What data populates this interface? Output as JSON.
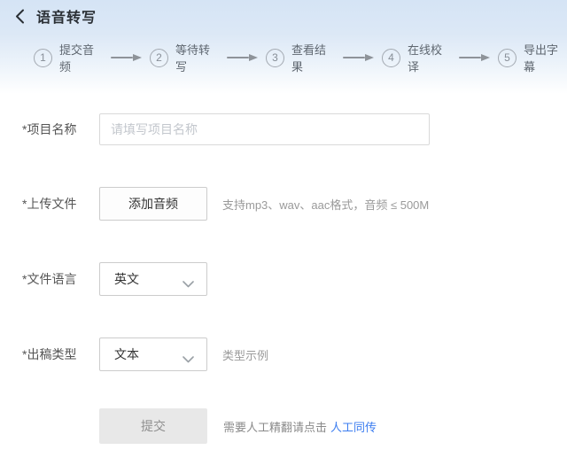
{
  "header": {
    "title": "语音转写",
    "back_icon": "chevron-left"
  },
  "steps": [
    {
      "number": "1",
      "label": "提交音频"
    },
    {
      "number": "2",
      "label": "等待转写"
    },
    {
      "number": "3",
      "label": "查看结果"
    },
    {
      "number": "4",
      "label": "在线校译"
    },
    {
      "number": "5",
      "label": "导出字幕"
    }
  ],
  "form": {
    "project_name": {
      "label": "*项目名称",
      "value": "",
      "placeholder": "请填写项目名称"
    },
    "upload": {
      "label": "*上传文件",
      "button_label": "添加音频",
      "hint": "支持mp3、wav、aac格式，音频 ≤ 500M"
    },
    "language": {
      "label": "*文件语言",
      "selected": "英文",
      "dropdown_icon": "chevron-down"
    },
    "output_type": {
      "label": "*出稿类型",
      "selected": "文本",
      "dropdown_icon": "chevron-down",
      "example_label": "类型示例"
    },
    "submit": {
      "button_label": "提交",
      "note": "需要人工精翻请点击",
      "link_label": "人工同传"
    }
  },
  "colors": {
    "header_gradient_top": "#d5e4f5",
    "link_blue": "#3c7df0",
    "step_gray": "#8e9399",
    "border_gray": "#cccccc",
    "disabled_button_bg": "#e8e8e8"
  }
}
